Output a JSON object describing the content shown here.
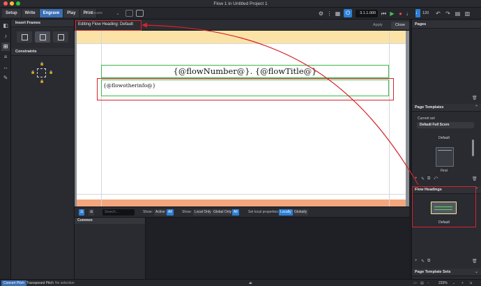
{
  "window": {
    "title": "Flow 1 in Untitled Project 1"
  },
  "toolbar": {
    "modes": [
      "Setup",
      "Write",
      "Engrave",
      "Play",
      "Print"
    ],
    "active_mode": "Engrave",
    "layout_name": "Full score",
    "time_display": "3.1.1.000",
    "tempo_value": "120"
  },
  "left_panel": {
    "insert_frames": "Insert Frames",
    "constraints": "Constraints"
  },
  "edit_bar": {
    "title": "Editing Flow Heading:  Default",
    "apply": "Apply",
    "close": "Close"
  },
  "page": {
    "heading_text": "{@flowNumber@}. {@flowTitle@}",
    "other_info_text": "{@flowotherinfo@}"
  },
  "lower_panel": {
    "search_placeholder": "Search...",
    "show_label": "Show:",
    "active": "Active",
    "all": "All",
    "show2_label": "Show:",
    "local_only": "Local Only",
    "global_only": "Global Only",
    "all2": "All",
    "set_local_props": "Set local properties:",
    "locally": "Locally",
    "globally": "Globally",
    "list_header": "Common"
  },
  "right_panel": {
    "pages": "Pages",
    "page_templates": "Page Templates",
    "current_set_label": "Current set",
    "current_set_value": "Default Full Score",
    "template_default": "Default",
    "template_first": "First",
    "flow_headings": "Flow Headings",
    "flow_heading_default": "Default",
    "page_template_sets": "Page Template Sets"
  },
  "status_bar": {
    "concert_pitch": "Concert Pitch",
    "transposed_pitch": "Transposed Pitch",
    "selection": "No selection",
    "zoom": "233%"
  },
  "colors": {
    "accent": "#3a6fb5",
    "annotation": "#d6232b",
    "frame": "#3cb94a"
  }
}
